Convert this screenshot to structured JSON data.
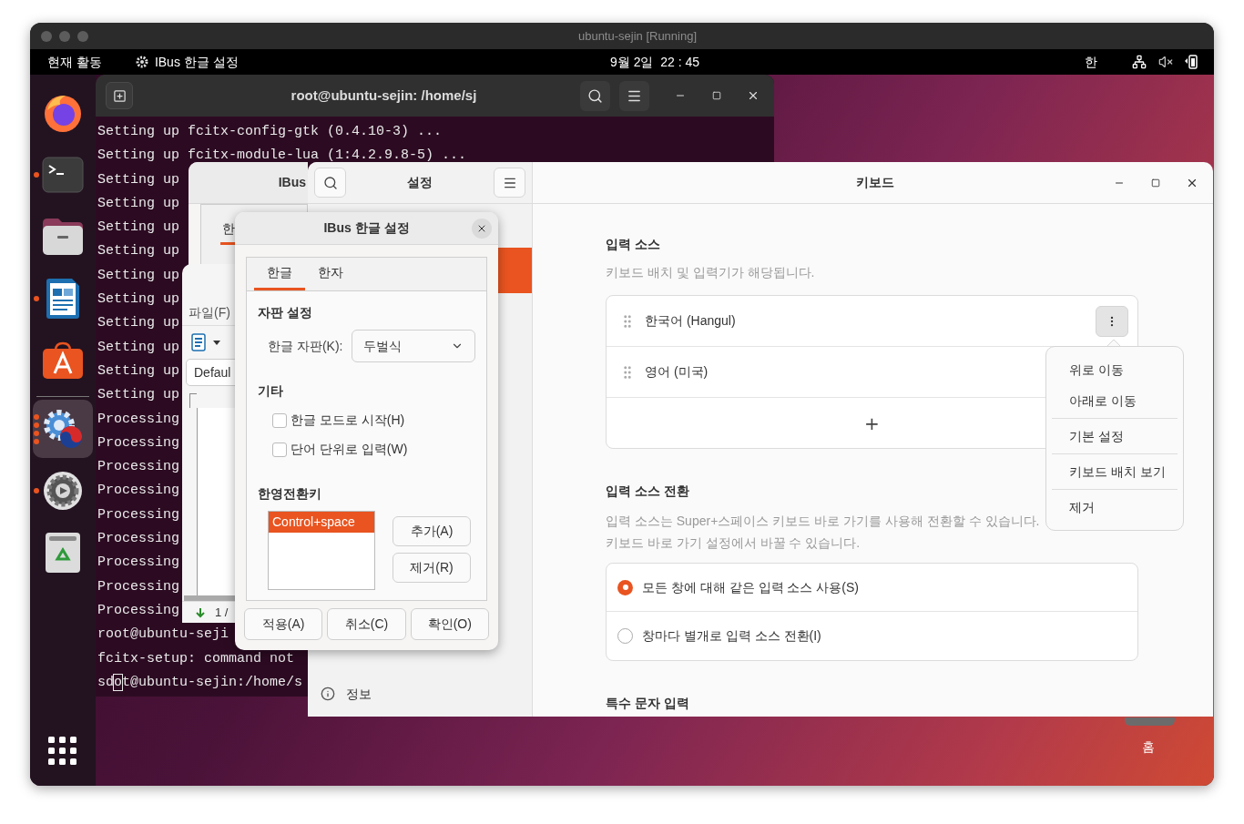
{
  "host_window": {
    "title": "ubuntu-sejin [Running]"
  },
  "top_bar": {
    "activities": "현재 활동",
    "app": "IBus 한글 설정",
    "clock": "9월 2일  22 : 45",
    "input_indicator": "한"
  },
  "dock": {
    "items": [
      {
        "kind": "firefox",
        "running": false,
        "selected": false
      },
      {
        "kind": "terminal",
        "running": true,
        "selected": false
      },
      {
        "kind": "files",
        "running": false,
        "selected": false
      },
      {
        "kind": "writer",
        "running": true,
        "selected": false
      },
      {
        "kind": "software",
        "running": false,
        "selected": false
      },
      {
        "kind": "separator"
      },
      {
        "kind": "ibus",
        "running": true,
        "selected": true
      },
      {
        "kind": "settings",
        "running": true,
        "selected": false
      },
      {
        "kind": "trash",
        "running": false,
        "selected": false
      }
    ]
  },
  "terminal": {
    "title": "root@ubuntu-sejin: /home/sj",
    "lines": [
      "Setting up fcitx-config-gtk (0.4.10-3) ...",
      "Setting up fcitx-module-lua (1:4.2.9.8-5) ...",
      "Setting up",
      "Setting up",
      "Setting up",
      "Setting up",
      "Setting up",
      "Setting up",
      "Setting up",
      "Setting up",
      "Setting up",
      "Setting up",
      "Processing",
      "Processing",
      "Processing",
      "Processing",
      "Processing",
      "Processing",
      "Processing",
      "Processing",
      "Processing",
      "root@ubuntu-seji",
      "fcitx-setup: command not"
    ],
    "prompt": {
      "before": "sd",
      "cursor": "o",
      "after": "t@ubuntu-sejin:/home/s"
    }
  },
  "ibus_back_window": {
    "title": "IBus",
    "tab": "한"
  },
  "writer_window": {
    "menu": "파일(F)",
    "style_box": "Defaul",
    "page_status": "1 /"
  },
  "settings": {
    "title": "설정",
    "sidebar": {
      "items": [
        {
          "selected": true
        },
        {
          "label": "정보",
          "selected": false
        }
      ]
    }
  },
  "keyboard": {
    "title": "키보드",
    "input_sources": {
      "heading": "입력 소스",
      "description": "키보드 배치 및 입력기가 해당됩니다.",
      "sources": [
        {
          "name": "한국어 (Hangul)",
          "menu_open": true
        },
        {
          "name": "영어 (미국)"
        }
      ],
      "add": "+"
    },
    "source_menu": {
      "groups": [
        [
          "위로 이동",
          "아래로 이동"
        ],
        [
          "기본 설정"
        ],
        [
          "키보드 배치 보기"
        ],
        [
          "제거"
        ]
      ]
    },
    "switching": {
      "heading": "입력 소스 전환",
      "description": [
        "입력 소스는 Super+스페이스 키보드 바로 가기를 사용해 전환할 수 있습니다.",
        "키보드 바로 가기 설정에서 바꿀 수 있습니다."
      ],
      "options": [
        {
          "label": "모든 창에 대해 같은 입력 소스 사용(S)",
          "selected": true
        },
        {
          "label": "창마다 별개로 입력 소스 전환(I)",
          "selected": false
        }
      ]
    },
    "special": {
      "heading": "특수 문자 입력"
    }
  },
  "ibus_dialog": {
    "title": "IBus 한글 설정",
    "tabs": [
      {
        "label": "한글",
        "selected": true
      },
      {
        "label": "한자",
        "selected": false
      }
    ],
    "layout_heading": "자판 설정",
    "layout_label": "한글 자판(K):",
    "layout_value": "두벌식",
    "other_heading": "기타",
    "checkboxes": [
      {
        "label": "한글 모드로 시작(H)",
        "checked": false
      },
      {
        "label": "단어 단위로 입력(W)",
        "checked": false
      }
    ],
    "hotkey_heading": "한영전환키",
    "hotkeys": [
      {
        "label": "Control+space",
        "selected": true
      }
    ],
    "side_buttons": [
      "추가(A)",
      "제거(R)"
    ],
    "footer_buttons": [
      "적용(A)",
      "취소(C)",
      "확인(O)"
    ]
  },
  "desktop": {
    "home_label": "홈"
  }
}
